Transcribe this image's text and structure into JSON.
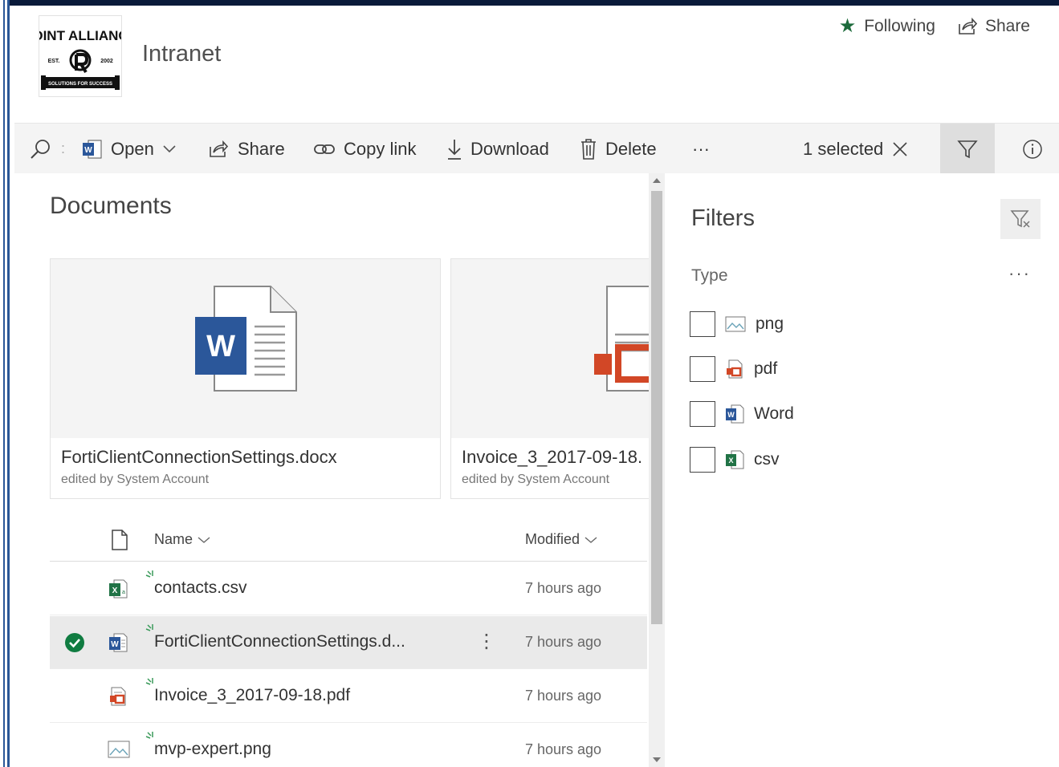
{
  "site": {
    "title": "Intranet",
    "logo_text": "POINT ALLIANCE",
    "logo_est": "EST.",
    "logo_year": "2002",
    "logo_tagline": "SOLUTIONS FOR SUCCESS"
  },
  "header": {
    "following_label": "Following",
    "share_label": "Share"
  },
  "toolbar": {
    "open_label": "Open",
    "share_label": "Share",
    "copy_link_label": "Copy link",
    "download_label": "Download",
    "delete_label": "Delete",
    "more_label": "···",
    "selected_label": "1 selected"
  },
  "documents": {
    "title": "Documents",
    "tiles": [
      {
        "name": "FortiClientConnectionSettings.docx",
        "edited_by": "edited by System Account"
      },
      {
        "name": "Invoice_3_2017-09-18.",
        "edited_by": "edited by System Account"
      }
    ],
    "columns": {
      "name": "Name",
      "modified": "Modified"
    },
    "rows": [
      {
        "name": "contacts.csv",
        "modified": "7 hours ago",
        "type": "csv",
        "selected": false
      },
      {
        "name": "FortiClientConnectionSettings.d...",
        "modified": "7 hours ago",
        "type": "word",
        "selected": true
      },
      {
        "name": "Invoice_3_2017-09-18.pdf",
        "modified": "7 hours ago",
        "type": "pdf",
        "selected": false
      },
      {
        "name": "mvp-expert.png",
        "modified": "7 hours ago",
        "type": "png",
        "selected": false
      }
    ]
  },
  "filters": {
    "title": "Filters",
    "type_label": "Type",
    "more_label": "···",
    "options": [
      {
        "label": "png",
        "icon": "image-file-icon"
      },
      {
        "label": "pdf",
        "icon": "pdf-file-icon"
      },
      {
        "label": "Word",
        "icon": "word-file-icon"
      },
      {
        "label": "csv",
        "icon": "excel-file-icon"
      }
    ]
  },
  "colors": {
    "word_blue": "#2b579a",
    "excel_green": "#217346",
    "pdf_red": "#d24726",
    "check_green": "#107c41",
    "star_green": "#1d6b3c"
  }
}
